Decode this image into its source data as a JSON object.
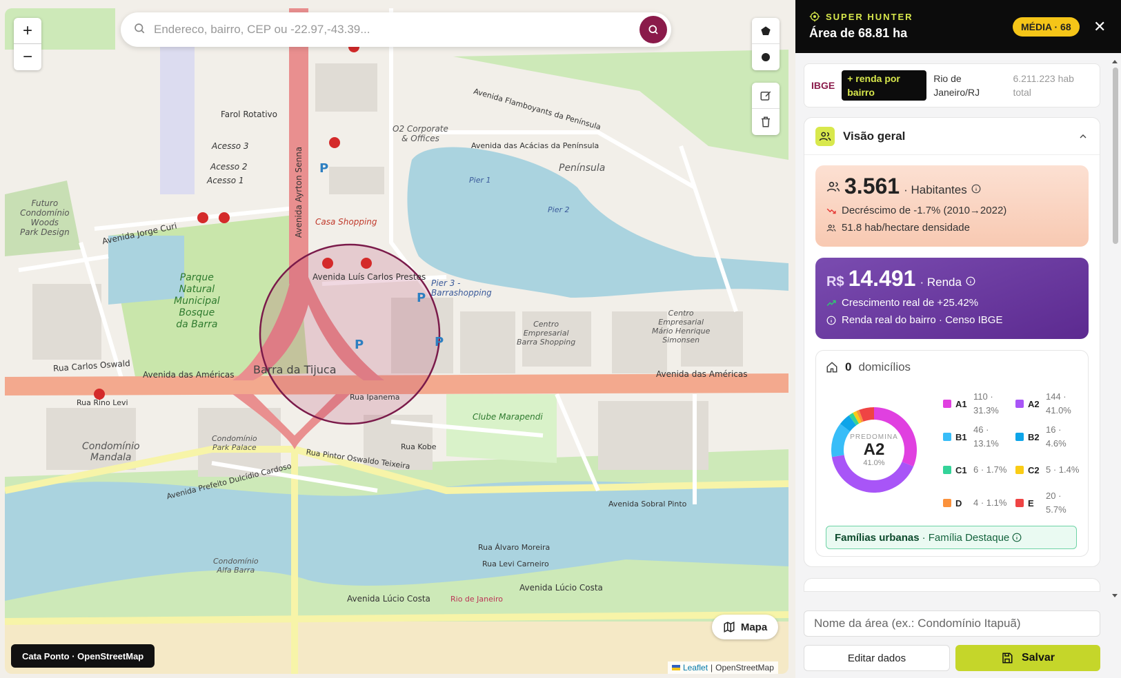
{
  "map": {
    "search_placeholder": "Endereco, bairro, CEP ou -22.97,-43.39...",
    "zoom_in": "+",
    "zoom_out": "−",
    "mapa_label": "Mapa",
    "source_tag": "Cata Ponto · OpenStreetMap",
    "attribution_leaflet": "Leaflet",
    "attribution_osm": "OpenStreetMap",
    "labels": {
      "farol": "Farol Rotativo",
      "acesso3": "Acesso 3",
      "acesso2": "Acesso 2",
      "acesso1": "Acesso 1",
      "futuro": "Futuro\nCondomínio\nWoods\nPark Design",
      "jorge_curi": "Avenida Jorge Curi",
      "parque": "Parque\nNatural\nMunicipal\nBosque\nda Barra",
      "carlos_oswald": "Rua Carlos Oswald",
      "americas_left": "Avenida das Américas",
      "americas_right": "Avenida das Américas",
      "barra_tijuca": "Barra da Tijuca",
      "luis_carlos": "Avenida Luís Carlos Prestes",
      "casa_shopping": "Casa Shopping",
      "o2": "O2 Corporate\n& Offices",
      "peninsula": "Península",
      "pier1": "Pier 1",
      "pier2": "Pier 2",
      "pier3": "Pier 3 -\nBarrashopping",
      "centro_emp1": "Centro\nEmpresarial\nBarra Shopping",
      "centro_emp2": "Centro\nEmpresarial\nMário Henrique\nSimonsen",
      "clube": "Clube Marapendi",
      "condominio_palace": "Condomínio\nPark Palace",
      "condominio_mandala": "Condomínio\nMandala",
      "condominio_alfa": "Condomínio\nAlfa Barra",
      "lucio_costa": "Avenida Lúcio Costa",
      "lucio_costa2": "Avenida Lúcio Costa",
      "sobral_pinto": "Avenida Sobral Pinto",
      "rio_de_janeiro": "Rio de Janeiro",
      "ayrton_senna": "Avenida Ayrton Senna",
      "rua_ipanema": "Rua Ipanema",
      "rua_kobe": "Rua Kobe",
      "pintor": "Rua Pintor Oswaldo Teixeira",
      "prefeito": "Avenida Prefeito Dulcídio Cardoso",
      "rino_levi": "Rua Rino Levi",
      "alvaro": "Rua Álvaro Moreira",
      "levi_carneiro": "Rua Levi Carneiro",
      "flamboyants": "Avenida Flamboyants da Península",
      "acacias": "Avenida das Acácias da Península"
    }
  },
  "panel": {
    "brand": "SUPER HUNTER",
    "title": "Área de 68.81 ha",
    "score": "MÉDIA · 68",
    "close": "✕",
    "ibge": "IBGE",
    "renda_chip": "+ renda por bairro",
    "city": "Rio de Janeiro/RJ",
    "population": "6.211.223 hab total",
    "overview_title": "Visão geral",
    "habitantes": {
      "value": "3.561",
      "label": "· Habitantes",
      "trend": "Decréscimo de -1.7% (2010→2022)",
      "density": "51.8 hab/hectare densidade"
    },
    "renda": {
      "currency": "R$",
      "value": "14.491",
      "label": "· Renda",
      "growth": "Crescimento real de +25.42%",
      "note": "Renda real do bairro · Censo IBGE"
    },
    "domicilios": {
      "count": "0",
      "label": "domicílios",
      "predomina_label": "PREDOMINA",
      "predomina_class": "A2",
      "predomina_pct": "41.0%",
      "familia_bold": "Famílias urbanas",
      "familia_rest": "· Família Destaque"
    },
    "name_placeholder": "Nome da área (ex.: Condomínio Itapuã)",
    "edit_label": "Editar dados",
    "save_label": "Salvar"
  },
  "chart_data": {
    "type": "pie",
    "title": "",
    "categories": [
      "A1",
      "A2",
      "B1",
      "B2",
      "C1",
      "C2",
      "D",
      "E"
    ],
    "values": [
      110,
      144,
      46,
      16,
      6,
      5,
      4,
      20
    ],
    "percent_labels": [
      "31.3%",
      "41.0%",
      "13.1%",
      "4.6%",
      "1.7%",
      "1.4%",
      "1.1%",
      "5.7%"
    ],
    "colors": [
      "#e040e0",
      "#a855f7",
      "#38bdf8",
      "#0ea5e9",
      "#34d399",
      "#facc15",
      "#fb923c",
      "#ef4444"
    ],
    "legend": "right"
  }
}
